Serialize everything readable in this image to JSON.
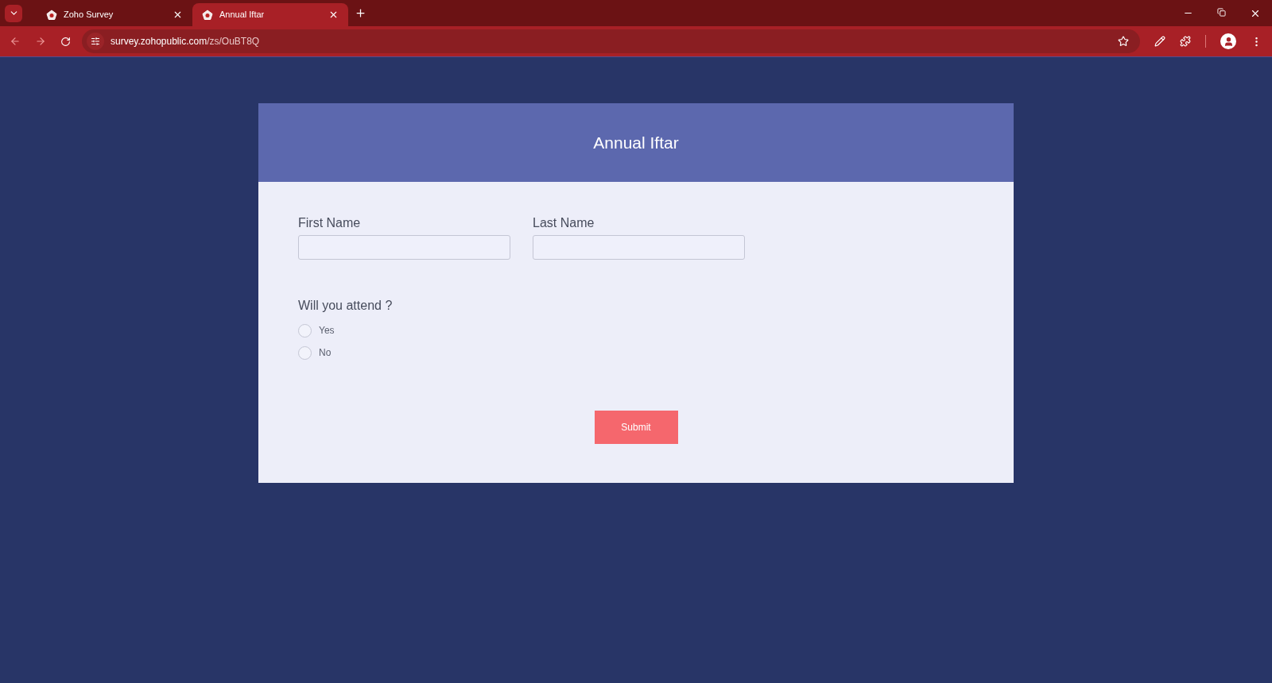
{
  "browser": {
    "tabs": [
      {
        "title": "Zoho Survey",
        "selected": false
      },
      {
        "title": "Annual Iftar",
        "selected": true
      }
    ],
    "url": {
      "host": "survey.zohopublic.com",
      "path": "/zs/OuBT8Q"
    }
  },
  "form": {
    "title": "Annual Iftar",
    "fields": [
      {
        "label": "First Name"
      },
      {
        "label": "Last Name"
      }
    ],
    "question": {
      "label": "Will you attend ?",
      "options": [
        {
          "label": "Yes",
          "selected": false
        },
        {
          "label": "No",
          "selected": false
        }
      ]
    },
    "submit": "Submit"
  }
}
